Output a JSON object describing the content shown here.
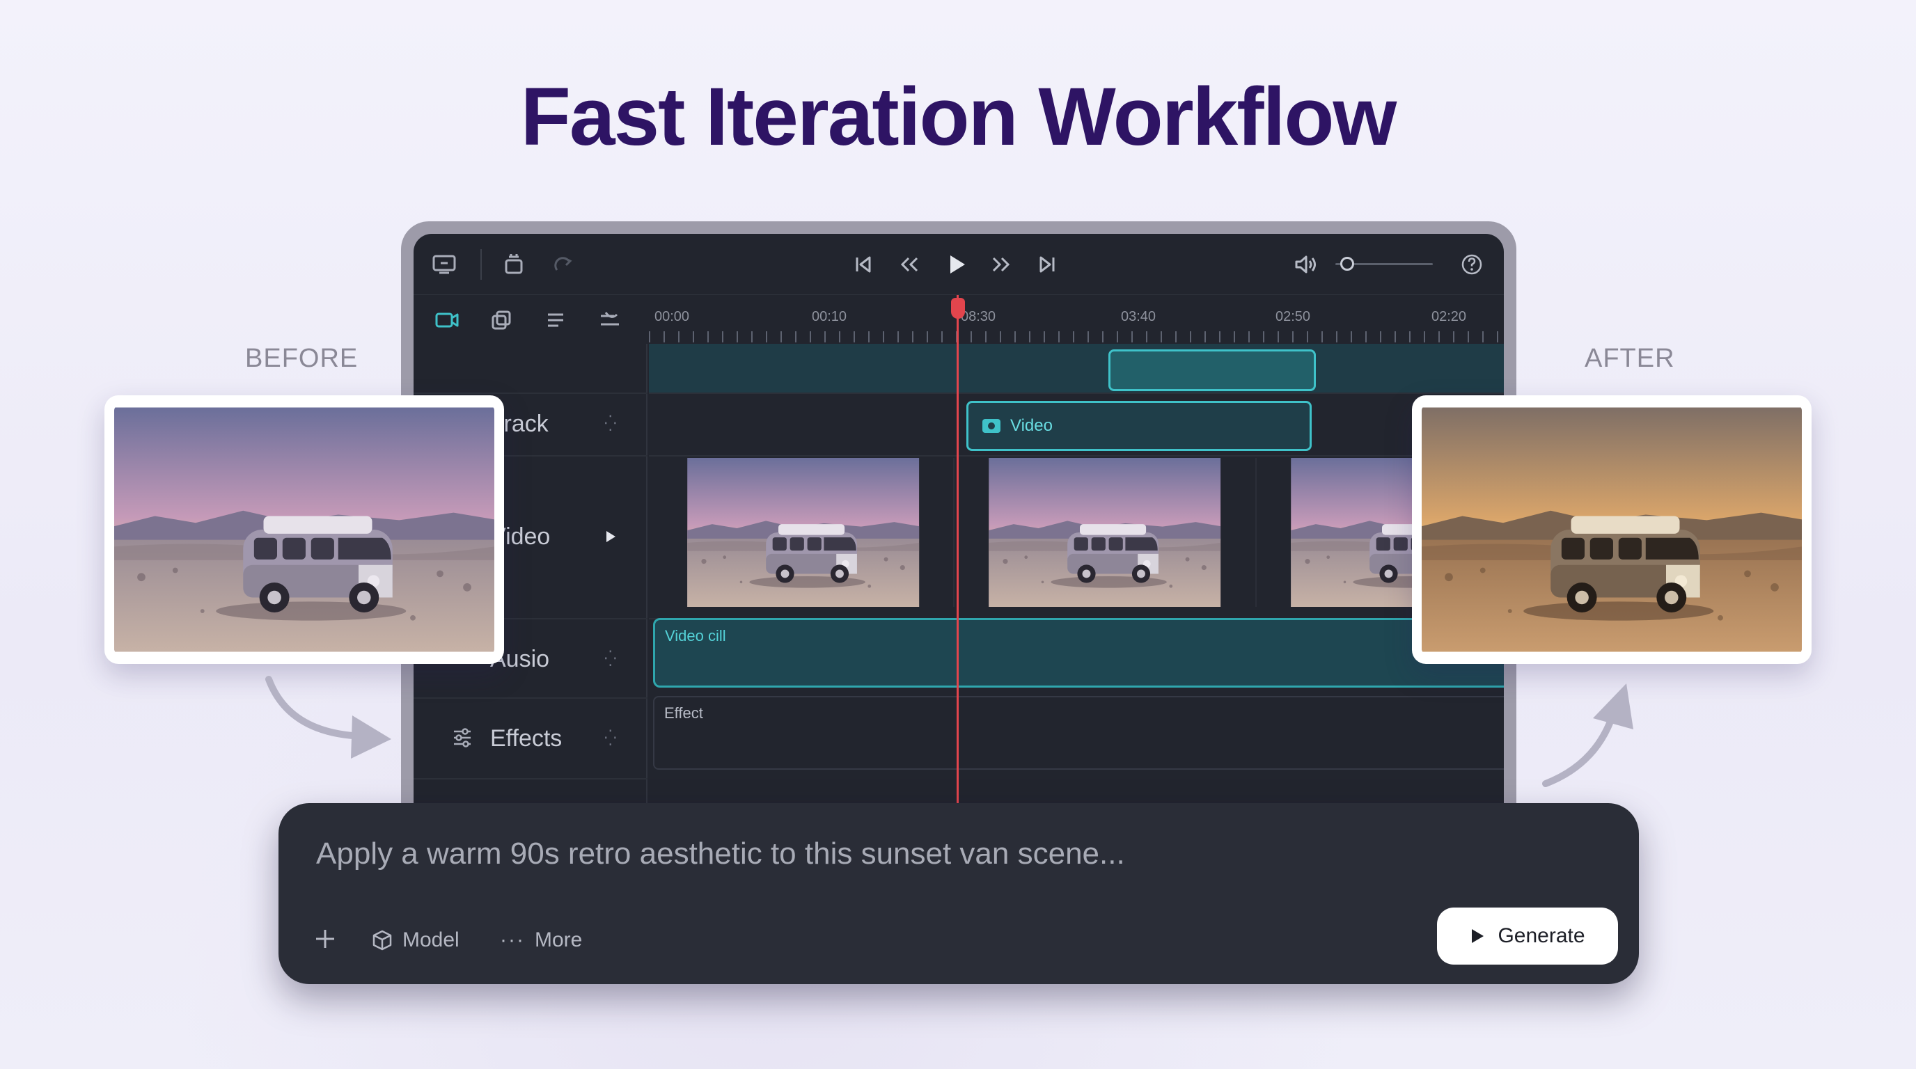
{
  "page": {
    "title": "Fast Iteration Workflow"
  },
  "labels": {
    "before": "BEFORE",
    "after": "AFTER"
  },
  "toolbar": {
    "icons": [
      "monitor-icon",
      "layers-icon",
      "redo-icon",
      "skip-back-icon",
      "rewind-icon",
      "play-icon",
      "fast-forward-icon",
      "skip-forward-icon",
      "volume-icon",
      "help-icon"
    ],
    "volume_level": 0.12
  },
  "timeline": {
    "ruler_labels": [
      "00:00",
      "00:10",
      "08:30",
      "03:40",
      "02:50",
      "02:20"
    ],
    "tracks": [
      {
        "label": "Track"
      },
      {
        "label": "Video"
      },
      {
        "label": "Ausio"
      },
      {
        "label": "Effects"
      }
    ],
    "clips": {
      "video_label": "Video",
      "audio_label": "Video cill",
      "effect_label": "Effect"
    }
  },
  "prompt": {
    "text": "Apply a warm 90s retro aesthetic to this sunset van scene...",
    "model_label": "Model",
    "more_label": "More",
    "generate_label": "Generate"
  },
  "colors": {
    "title": "#2e1464",
    "accent_teal": "#3fc2c9",
    "playhead": "#e2454d",
    "editor_bg": "#22252e"
  }
}
